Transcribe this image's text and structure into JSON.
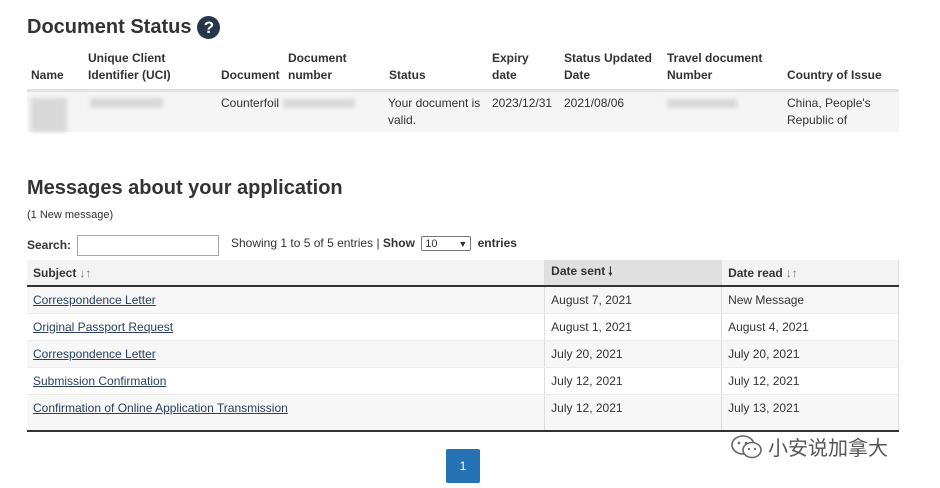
{
  "document_status": {
    "title": "Document Status",
    "help_icon": "question-circle-icon",
    "headers": {
      "name": "Name",
      "uci": "Unique Client Identifier (UCI)",
      "document": "Document",
      "document_number": "Document number",
      "status": "Status",
      "expiry": "Expiry date",
      "status_updated": "Status Updated Date",
      "travel_number": "Travel document Number",
      "country": "Country of Issue"
    },
    "row": {
      "document": "Counterfoil",
      "status": "Your document is valid.",
      "expiry": "2023/12/31",
      "status_updated": "2021/08/06",
      "country": "China, People's Republic of"
    }
  },
  "messages": {
    "title": "Messages about your application",
    "new_note": "(1 New message)",
    "search_label": "Search:",
    "search_value": "",
    "showing": "Showing 1 to 5 of 5 entries",
    "separator": "|",
    "show_label": "Show",
    "show_value": "10",
    "entries_label": "entries",
    "columns": {
      "subject": "Subject",
      "date_sent": "Date sent",
      "date_read": "Date read"
    },
    "rows": [
      {
        "subject": "Correspondence Letter",
        "sent": "August 7, 2021",
        "read": "New Message"
      },
      {
        "subject": "Original Passport Request",
        "sent": "August 1, 2021",
        "read": "August 4, 2021"
      },
      {
        "subject": "Correspondence Letter",
        "sent": "July 20, 2021",
        "read": "July 20, 2021"
      },
      {
        "subject": "Submission Confirmation",
        "sent": "July 12, 2021",
        "read": "July 12, 2021"
      },
      {
        "subject": "Confirmation of Online Application Transmission",
        "sent": "July 12, 2021",
        "read": "July 13, 2021"
      }
    ],
    "page": "1"
  },
  "watermark": {
    "text": "小安说加拿大",
    "icon": "wechat-icon"
  }
}
